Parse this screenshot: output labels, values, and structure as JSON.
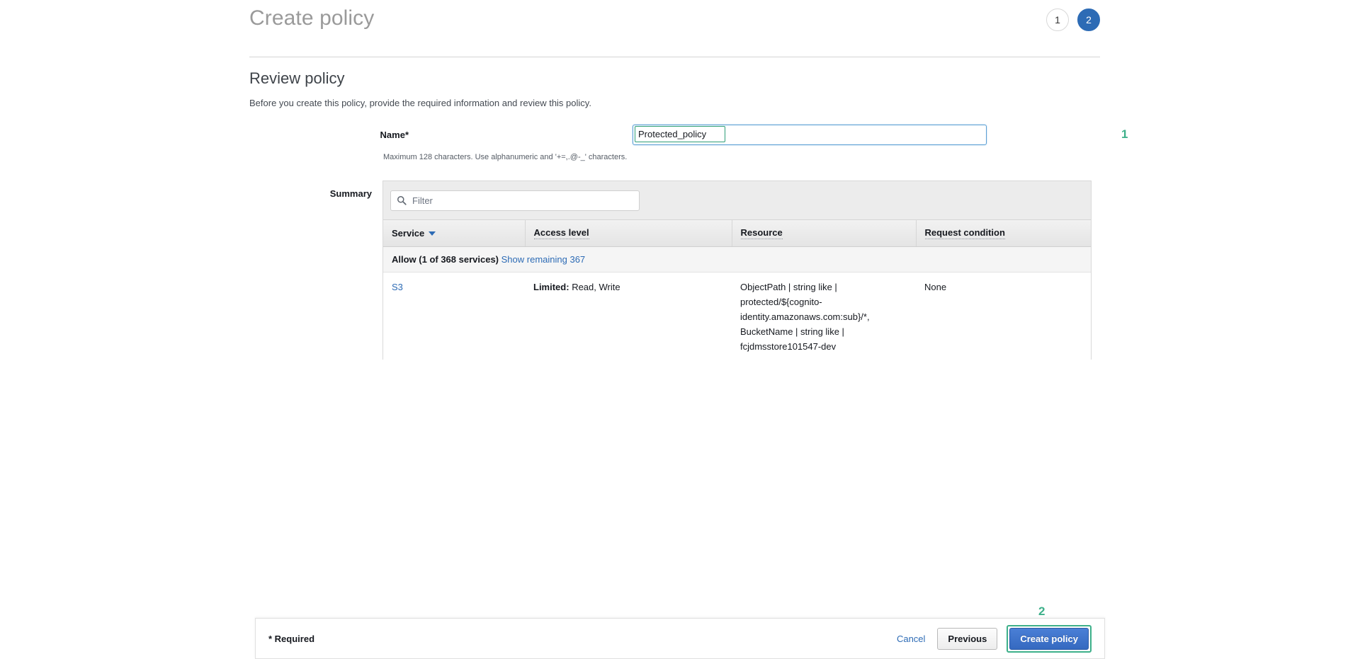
{
  "header": {
    "title": "Create policy",
    "steps": [
      {
        "label": "1",
        "state": "inactive"
      },
      {
        "label": "2",
        "state": "active"
      }
    ]
  },
  "section": {
    "title": "Review policy",
    "subtitle": "Before you create this policy, provide the required information and review this policy."
  },
  "name_field": {
    "label": "Name*",
    "value": "Protected_policy",
    "placeholder": "",
    "hint": "Maximum 128 characters. Use alphanumeric and '+=,.@-_' characters."
  },
  "annotations": {
    "marker_one": "1",
    "marker_two": "2"
  },
  "summary": {
    "label": "Summary",
    "filter": {
      "placeholder": "Filter",
      "value": "",
      "icon": "search-icon"
    },
    "columns": [
      {
        "label": "Service",
        "sortable": true,
        "sort_direction": "desc",
        "dotted": false
      },
      {
        "label": "Access level",
        "sortable": false,
        "dotted": true
      },
      {
        "label": "Resource",
        "sortable": false,
        "dotted": true
      },
      {
        "label": "Request condition",
        "sortable": false,
        "dotted": true
      }
    ],
    "group": {
      "label": "Allow (1 of 368 services)",
      "show_remaining_link": "Show remaining 367"
    },
    "rows": [
      {
        "service": "S3",
        "access_level_prefix": "Limited:",
        "access_level": "Read, Write",
        "resource": "ObjectPath | string like | protected/${cognito-identity.amazonaws.com:sub}/*, BucketName | string like | fcjdmsstore101547-dev",
        "request_condition": "None"
      }
    ]
  },
  "footer": {
    "required_note": "* Required",
    "cancel_label": "Cancel",
    "previous_label": "Previous",
    "create_label": "Create policy"
  },
  "colors": {
    "accent_blue": "#2d6bb5",
    "primary_button": "#3569c0",
    "annotation_green": "#3db08a",
    "title_gray": "#9a9a9a"
  }
}
